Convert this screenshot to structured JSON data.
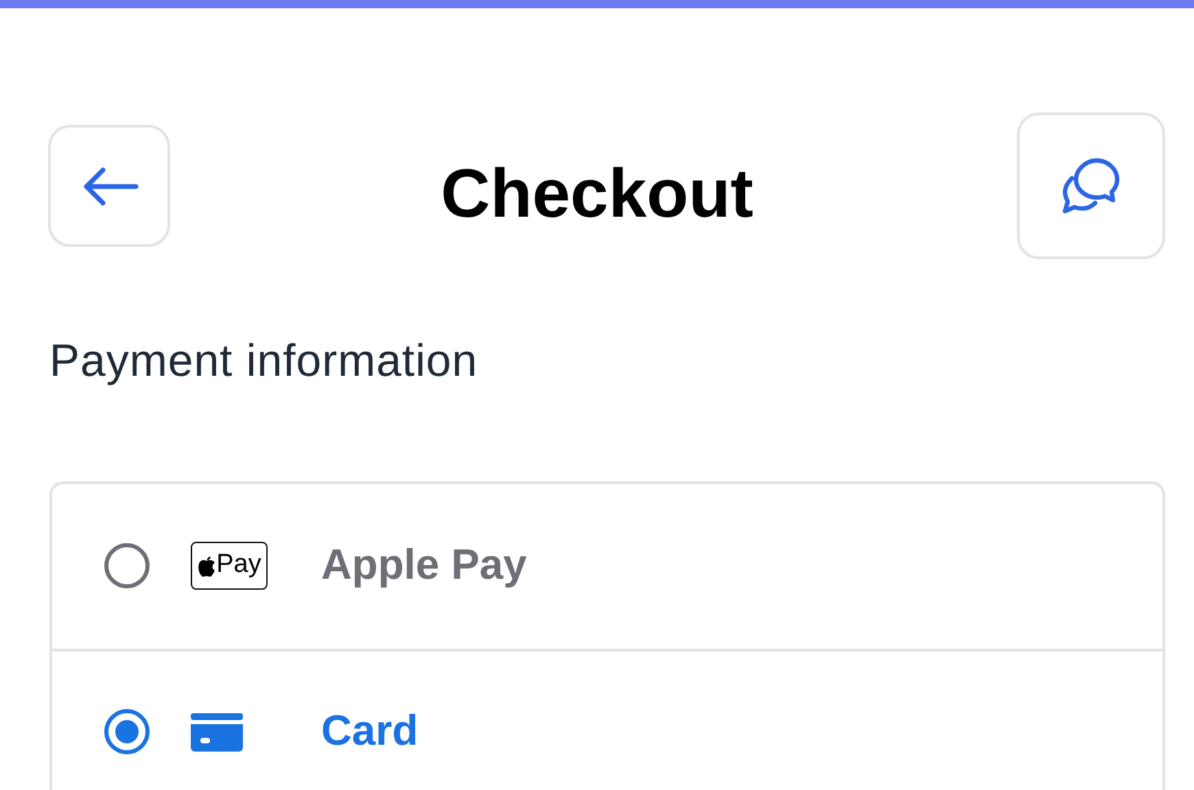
{
  "header": {
    "title": "Checkout"
  },
  "section": {
    "heading": "Payment information"
  },
  "methods": [
    {
      "kind": "apple_pay",
      "label": "Apple Pay",
      "badge_text": "Pay",
      "selected": false
    },
    {
      "kind": "card",
      "label": "Card",
      "selected": true
    }
  ]
}
